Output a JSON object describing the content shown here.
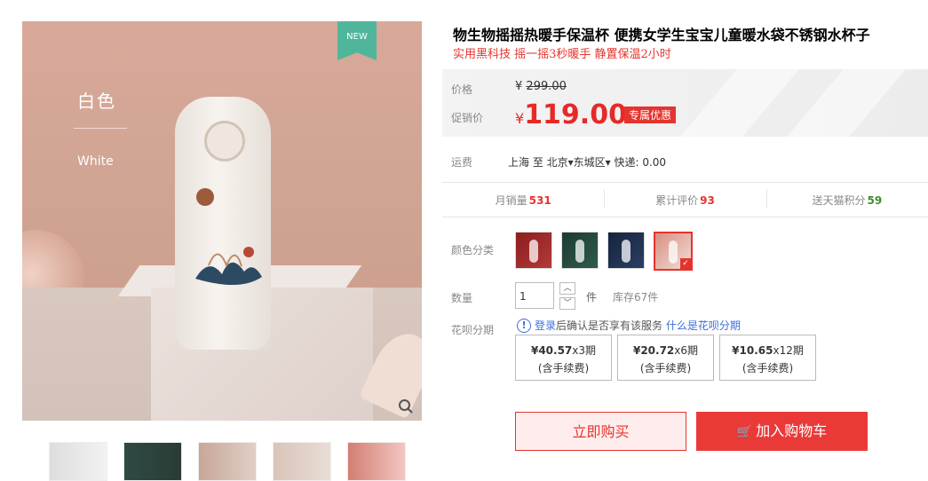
{
  "gallery": {
    "badge": "NEW",
    "color_cn": "白色",
    "color_en": "White",
    "zoom_icon": "search-icon",
    "thumbnails": [
      "thumb-1",
      "thumb-2",
      "thumb-3",
      "thumb-4",
      "thumb-5"
    ]
  },
  "product": {
    "title": "物生物摇摇热暖手保温杯 便携女学生宝宝儿童暖水袋不锈钢水杯子",
    "subtitle": "实用黑科技 摇一摇3秒暖手 静置保温2小时"
  },
  "price": {
    "label": "价格",
    "currency": "¥",
    "original": "299.00",
    "promo_label": "促销价",
    "promo": "119.00",
    "promo_tag": "专属优惠"
  },
  "shipping": {
    "label": "运费",
    "value": "上海 至 北京▾东城区▾ 快递: 0.00"
  },
  "stats": {
    "monthly_sales_label": "月销量",
    "monthly_sales": "531",
    "reviews_label": "累计评价",
    "reviews": "93",
    "points_label": "送天猫积分",
    "points": "59"
  },
  "options": {
    "color_label": "颜色分类",
    "quantity_label": "数量",
    "quantity_value": "1",
    "unit": "件",
    "stock": "库存67件"
  },
  "huabei": {
    "label": "花呗分期",
    "login": "登录",
    "notice": "后确认是否享有该服务",
    "link": "什么是花呗分期",
    "plans": [
      {
        "amount": "¥40.57",
        "periods": "x3期",
        "fee": "(含手续费)"
      },
      {
        "amount": "¥20.72",
        "periods": "x6期",
        "fee": "(含手续费)"
      },
      {
        "amount": "¥10.65",
        "periods": "x12期",
        "fee": "(含手续费)"
      }
    ]
  },
  "actions": {
    "buy_now": "立即购买",
    "add_to_cart": "加入购物车"
  },
  "colors": {
    "accent": "#e5342e",
    "link": "#3c6fd6",
    "points": "#3f8e2c",
    "badge": "#4fb59b"
  }
}
